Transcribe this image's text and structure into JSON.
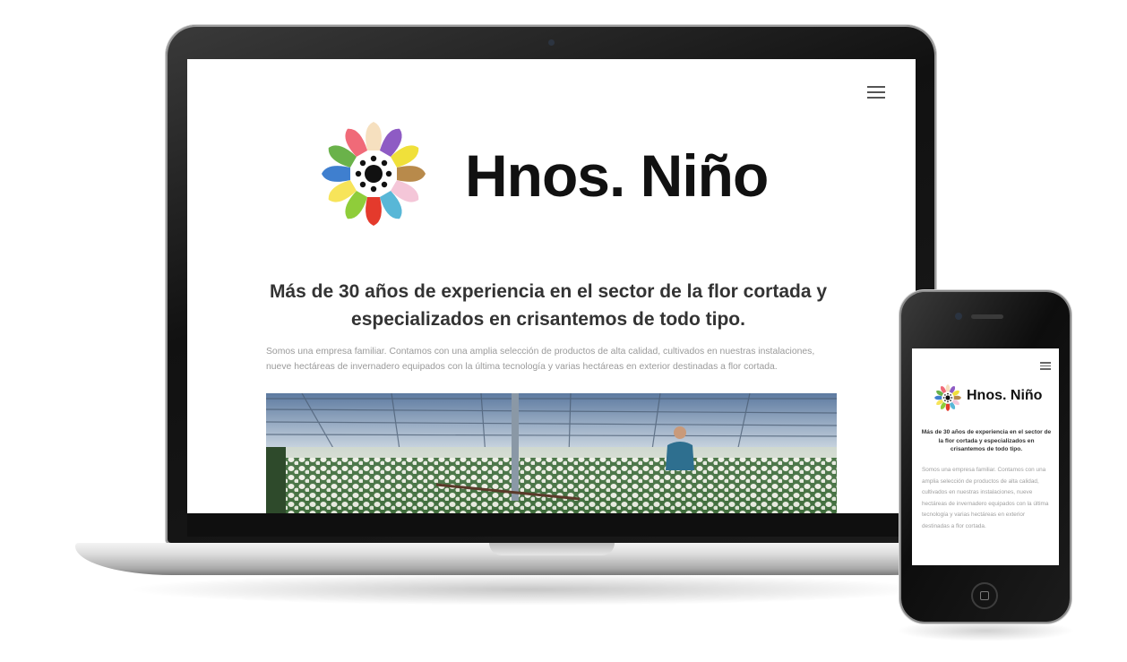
{
  "site": {
    "brand_name": "Hnos. Niño",
    "headline": "Más de 30 años de experiencia en el sector de la flor cortada y especializados en crisantemos de todo tipo.",
    "body": "Somos una empresa familiar. Contamos con una amplia selección de productos de alta calidad, cultivados en nuestras instalaciones, nueve hectáreas de invernadero equipados con la última tecnología y varias hectáreas en exterior destinadas a flor cortada.",
    "menu_icon": "hamburger-menu-icon",
    "logo_icon": "multicolor-flower-logo"
  },
  "colors": {
    "petals": [
      "#f6e0bf",
      "#8e5bc4",
      "#f0e03a",
      "#b88a4b",
      "#f4c6d8",
      "#58b7d7",
      "#e43a2c",
      "#8fcd3a",
      "#f7e45a",
      "#3f7fcf",
      "#6ab24a",
      "#f06a78"
    ],
    "text_dark": "#111111",
    "headline": "#333333",
    "body_text": "#9a9a9a"
  }
}
